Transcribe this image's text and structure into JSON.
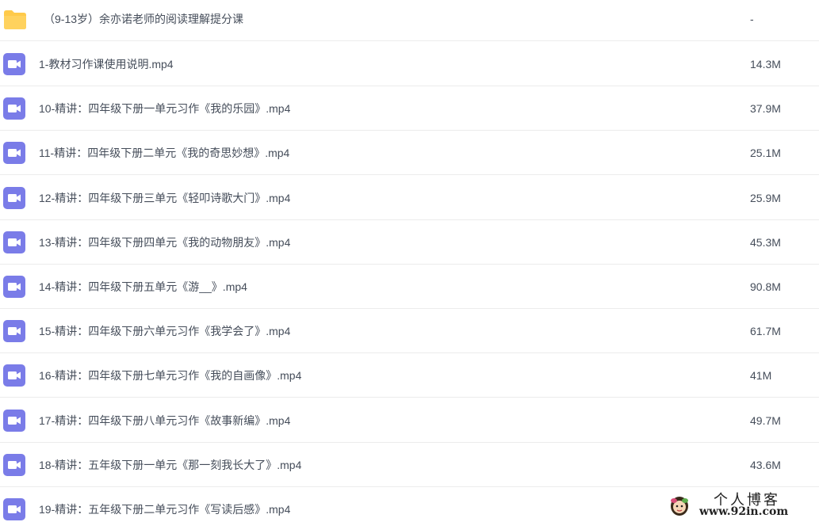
{
  "colors": {
    "video_icon": "#7a7ce8",
    "folder_icon": "#ffca4a",
    "text": "#454d5a",
    "divider": "#ececec"
  },
  "folder": {
    "icon": "folder-icon",
    "name": "（9-13岁）余亦诺老师的阅读理解提分课",
    "size": "-"
  },
  "files": [
    {
      "icon": "video-file-icon",
      "name": "1-教材习作课使用说明.mp4",
      "size": "14.3M"
    },
    {
      "icon": "video-file-icon",
      "name": "10-精讲：四年级下册一单元习作《我的乐园》.mp4",
      "size": "37.9M"
    },
    {
      "icon": "video-file-icon",
      "name": "11-精讲：四年级下册二单元《我的奇思妙想》.mp4",
      "size": "25.1M"
    },
    {
      "icon": "video-file-icon",
      "name": "12-精讲：四年级下册三单元《轻叩诗歌大门》.mp4",
      "size": "25.9M"
    },
    {
      "icon": "video-file-icon",
      "name": "13-精讲：四年级下册四单元《我的动物朋友》.mp4",
      "size": "45.3M"
    },
    {
      "icon": "video-file-icon",
      "name": "14-精讲：四年级下册五单元《游__》.mp4",
      "size": "90.8M"
    },
    {
      "icon": "video-file-icon",
      "name": "15-精讲：四年级下册六单元习作《我学会了》.mp4",
      "size": "61.7M"
    },
    {
      "icon": "video-file-icon",
      "name": "16-精讲：四年级下册七单元习作《我的自画像》.mp4",
      "size": "41M"
    },
    {
      "icon": "video-file-icon",
      "name": "17-精讲：四年级下册八单元习作《故事新编》.mp4",
      "size": "49.7M"
    },
    {
      "icon": "video-file-icon",
      "name": "18-精讲：五年级下册一单元《那一刻我长大了》.mp4",
      "size": "43.6M"
    },
    {
      "icon": "video-file-icon",
      "name": "19-精讲：五年级下册二单元习作《写读后感》.mp4",
      "size": ""
    }
  ],
  "watermark": {
    "title": "个人博客",
    "url": "www.92in.com"
  }
}
